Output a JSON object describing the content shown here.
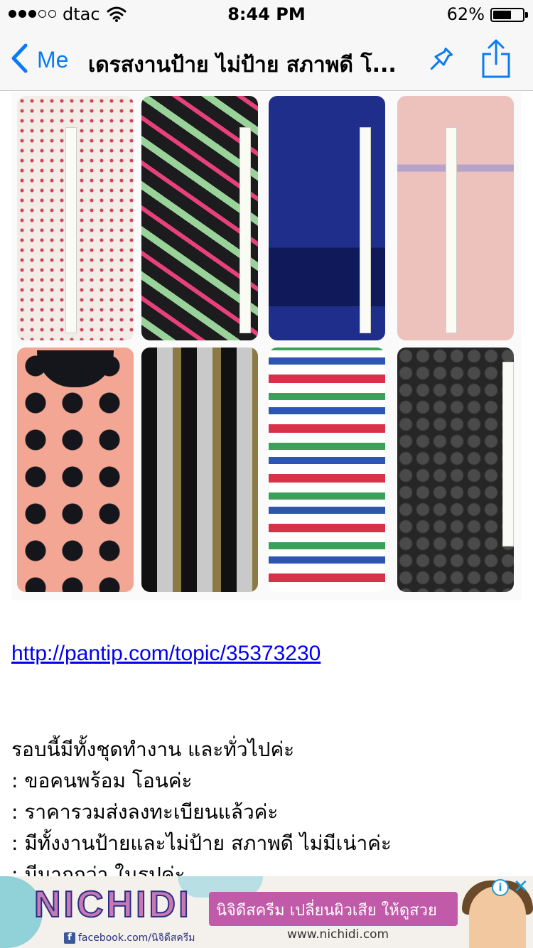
{
  "status_bar": {
    "carrier": "dtac",
    "time": "8:44 PM",
    "battery": "62%",
    "battery_level": 0.62,
    "signal_bars": 3,
    "signal_total": 5
  },
  "nav": {
    "back_label": "Me",
    "title": "เดรสงานป้าย ไม่ป้าย สภาพดี โ..."
  },
  "gallery": {
    "items": [
      {
        "name": "floral-print-romper",
        "bg": "#f3ece6",
        "pattern": "#c8485a"
      },
      {
        "name": "letter-print-romper",
        "bg": "#1c1c1e",
        "pattern": "#9ad39a"
      },
      {
        "name": "navy-blue-romper",
        "bg": "#1f2e8a",
        "pattern": "#101a5a"
      },
      {
        "name": "pink-button-dress",
        "bg": "#edc2bd",
        "pattern": "#b7a3c9"
      },
      {
        "name": "polka-dot-dress",
        "bg": "#f2a693",
        "pattern": "#15161c"
      },
      {
        "name": "striped-metallic-dress",
        "bg": "#2a2a2a",
        "pattern": "#c9c9c9"
      },
      {
        "name": "multicolor-block-print-romper",
        "bg": "#ffffff",
        "pattern": "#d8324a"
      },
      {
        "name": "black-lace-top",
        "bg": "#262626",
        "pattern": "#4a4a4a"
      }
    ]
  },
  "post": {
    "link": "http://pantip.com/topic/35373230",
    "lines": [
      "รอบนี้มีทั้งชุดทำงาน และทั่วไปค่ะ",
      ": ขอคนพร้อม โอนค่ะ",
      ": ราคารวมส่งลงทะเบียนแล้วค่ะ",
      ": มีทั้งงานป้ายและไม่ป้าย สภาพดี ไม่มีเน่าค่ะ",
      ": มีมากกว่า ในรูปค่ะ"
    ]
  },
  "ad": {
    "brand": "NICHIDI",
    "tagline": "นิจิดีสครีม เปลี่ยนผิวเสีย ให้ดูสวย",
    "facebook": "facebook.com/นิจิดีสครีม",
    "site": "www.nichidi.com",
    "info_label": "i",
    "close_label": "✕"
  }
}
